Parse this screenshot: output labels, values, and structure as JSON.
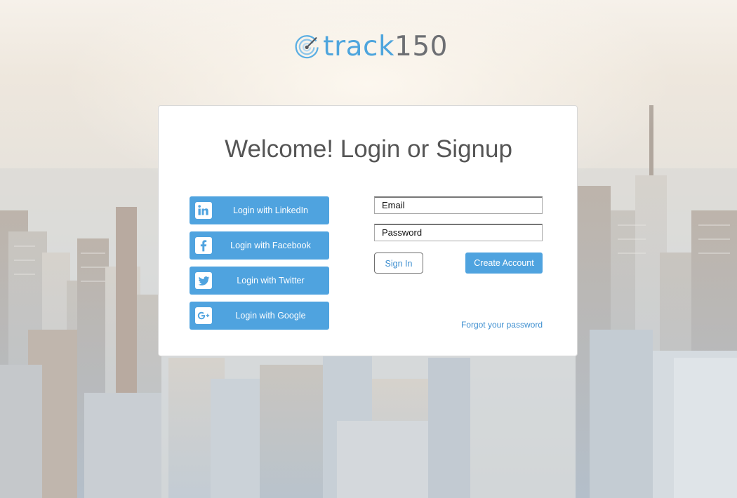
{
  "brand": {
    "name_part1": "track",
    "name_part2": "150"
  },
  "login_card": {
    "title": "Welcome! Login or Signup",
    "social_buttons": [
      {
        "label": "Login with LinkedIn",
        "icon": "linkedin-icon"
      },
      {
        "label": "Login with Facebook",
        "icon": "facebook-icon"
      },
      {
        "label": "Login with Twitter",
        "icon": "twitter-icon"
      },
      {
        "label": "Login with Google",
        "icon": "google-plus-icon"
      }
    ],
    "email_field": {
      "value": "Email"
    },
    "password_field": {
      "value": "Password"
    },
    "sign_in_label": "Sign In",
    "create_account_label": "Create Account",
    "forgot_password_label": "Forgot your password"
  },
  "colors": {
    "accent": "#4fa3df",
    "link": "#3e8fd0",
    "logo_blue": "#4ea5dd",
    "logo_gray": "#6d6f73",
    "title_text": "#555555"
  }
}
